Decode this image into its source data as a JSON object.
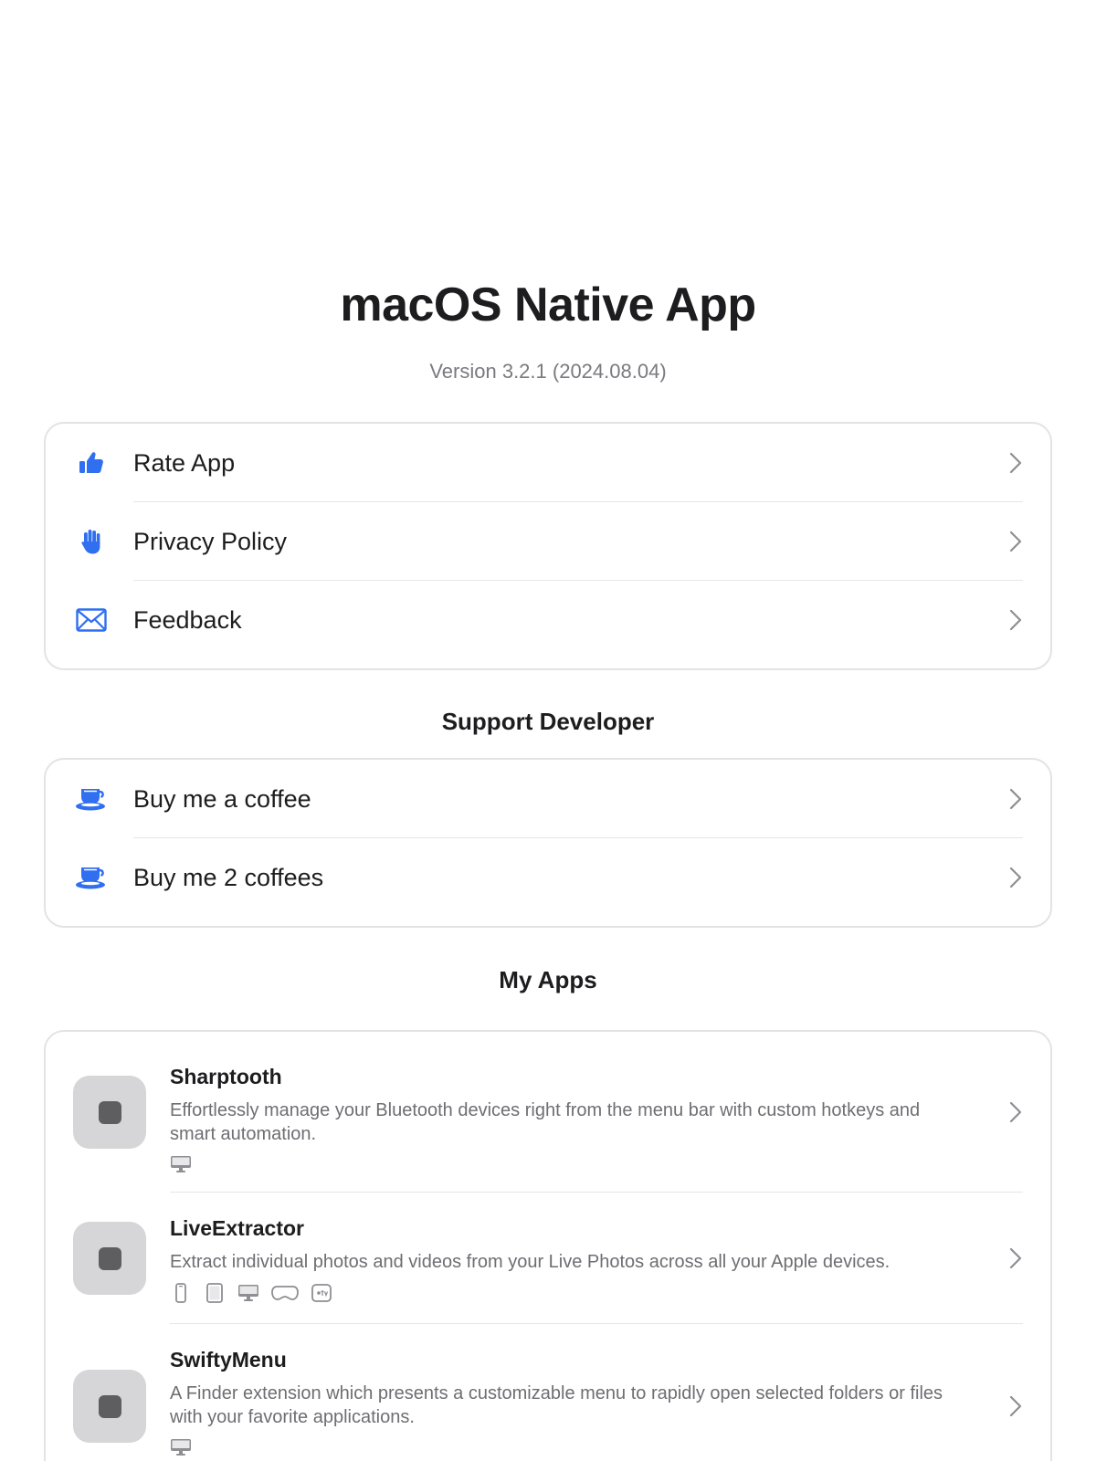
{
  "app": {
    "title": "macOS Native App",
    "version": "Version 3.2.1 (2024.08.04)"
  },
  "colors": {
    "accent": "#2f6ff0",
    "text_primary": "#1d1d1f",
    "text_secondary": "#6e6e73",
    "card_border": "#e3e3e6",
    "app_icon_bg": "#d6d6d8"
  },
  "links": [
    {
      "label": "Rate App",
      "icon": "thumbs-up-icon"
    },
    {
      "label": "Privacy Policy",
      "icon": "raised-hand-icon"
    },
    {
      "label": "Feedback",
      "icon": "envelope-icon"
    }
  ],
  "support": {
    "header": "Support Developer",
    "items": [
      {
        "label": "Buy me a coffee",
        "icon": "coffee-cup-icon"
      },
      {
        "label": "Buy me 2 coffees",
        "icon": "coffee-cup-icon"
      }
    ]
  },
  "my_apps": {
    "header": "My Apps",
    "items": [
      {
        "name": "Sharptooth",
        "description": "Effortlessly manage your Bluetooth devices right from the menu bar with custom hotkeys and smart automation.",
        "platforms": [
          "mac-icon"
        ]
      },
      {
        "name": "LiveExtractor",
        "description": "Extract individual photos and videos from your Live Photos across all your Apple devices.",
        "platforms": [
          "iphone-icon",
          "ipad-icon",
          "mac-icon",
          "vision-pro-icon",
          "apple-tv-icon"
        ]
      },
      {
        "name": "SwiftyMenu",
        "description": "A Finder extension which presents a customizable menu to rapidly open selected folders or files with your favorite applications.",
        "platforms": [
          "mac-icon"
        ]
      }
    ]
  }
}
